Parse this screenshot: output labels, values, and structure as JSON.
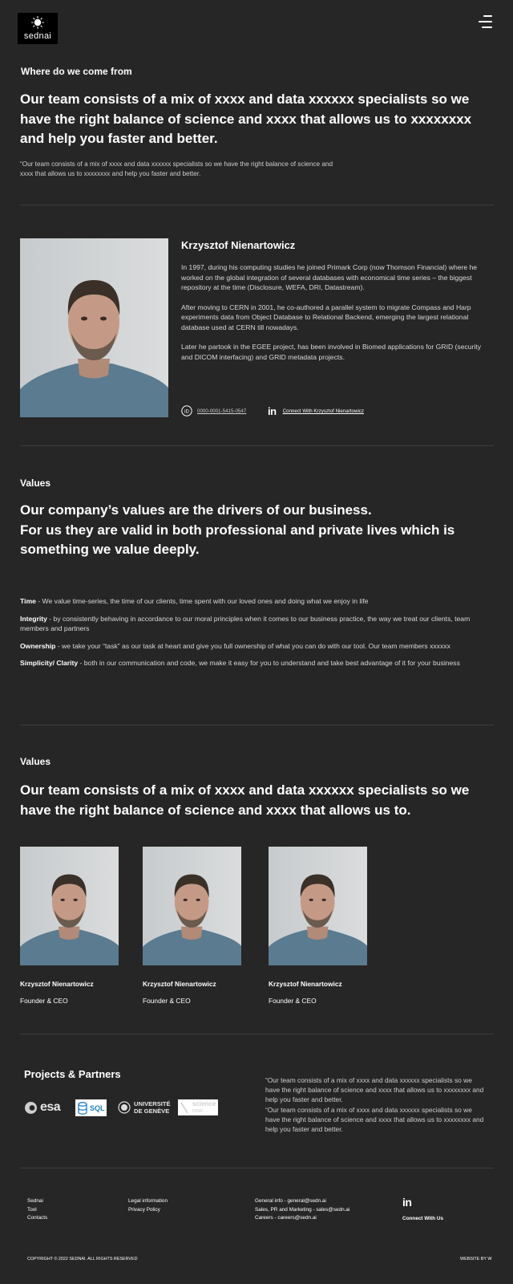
{
  "brand": {
    "name": "sednai"
  },
  "intro": {
    "eyebrow": "Where do we come from",
    "heading": "Our team consists of a mix of xxxx and data xxxxxx specialists so we have the right balance of science and xxxx that allows us to xxxxxxxx and help you faster and better.",
    "quote": "“Our team consists of a mix of xxxx and data xxxxxx specialists so we have the right balance of science and xxxx that allows us to xxxxxxxx and help you faster and better."
  },
  "founder": {
    "name": "Krzysztof Nienartowicz",
    "paragraphs": [
      "In 1997, during his computing studies he joined Primark Corp (now Thomson Financial) where he worked on the global integration of several databases with economical time series – the biggest repository at the time (Disclosure, WEFA, DRI, Datastream).",
      "After moving to CERN in 2001, he co-authored a parallel system to migrate Compass and Harp experiments data from Object Database to Relational Backend, emerging the largest relational database used at CERN till nowadays.",
      "Later he partook in the EGEE project, has been involved in Biomed applications for GRID (security and DICOM interfacing) and GRID metadata projects."
    ],
    "orcid_icon": "orcid-icon",
    "orcid": "0000-0001-5415-0547",
    "linkedin_icon": "linkedin-icon",
    "linkedin_label": "Connect With Krzysztof Nienartowicz"
  },
  "values": {
    "eyebrow": "Values",
    "heading_line1": "Our company’s values are the drivers of our business.",
    "heading_line2": "For us they are valid in both professional and private lives which is something we value deeply.",
    "items": [
      {
        "title": "Time",
        "text": " -  We value time-series, the time of our clients, time spent with our loved ones and doing what we enjoy in life"
      },
      {
        "title": "Integrity",
        "text": " - by consistently behaving in accordance to our moral principles when it comes to  our business practice, the way we treat our clients, team members and partners"
      },
      {
        "title": "Ownership",
        "text": " - we take your “task” as our task at heart and give you full ownership of what you can do with our tool. Our team members xxxxxx"
      },
      {
        "title": "Simplicity/ Clarity",
        "text": " - both in our communication and code, we make it easy for you to understand and take best advantage of it for your business"
      }
    ]
  },
  "team": {
    "eyebrow": "Values",
    "heading": "Our team consists of a mix of xxxx and data xxxxxx specialists so we have the right balance of science and xxxx that allows us to.",
    "members": [
      {
        "name": "Krzysztof Nienartowicz",
        "role": "Founder & CEO"
      },
      {
        "name": "Krzysztof Nienartowicz",
        "role": "Founder & CEO"
      },
      {
        "name": "Krzysztof Nienartowicz",
        "role": "Founder & CEO"
      }
    ]
  },
  "partners": {
    "title": "Projects & Partners",
    "logos": {
      "esa": "esa",
      "sql": "SQL",
      "geneve_1": "UNIVERSITÉ",
      "geneve_2": "DE GENÈVE",
      "science_1": "science",
      "science_2": "now"
    },
    "quote": "“Our team consists of a mix of xxxx and data xxxxxx specialists so we have the right balance of science and xxxx that allows us to xxxxxxxx and help you faster and better.\n“Our team consists of a mix of xxxx and data xxxxxx specialists so we have the right balance of science and xxxx that allows us to xxxxxxxx and help you faster and better."
  },
  "footer": {
    "col1": [
      "Sednai",
      "Tool",
      "Contacts"
    ],
    "col2": [
      "Legal information",
      "Privacy Policy"
    ],
    "col3": [
      "General info - general@sedn.ai",
      "Sales, PR and Marketing - sales@sedn.ai",
      "Careers - careers@sedn.ai"
    ],
    "connect": "Connect With Us",
    "copyright": "COPYRIGHT © 2022 SEDNAI. ALL RIGHTS RESERVED",
    "credit": "WEBSITE BY W"
  }
}
